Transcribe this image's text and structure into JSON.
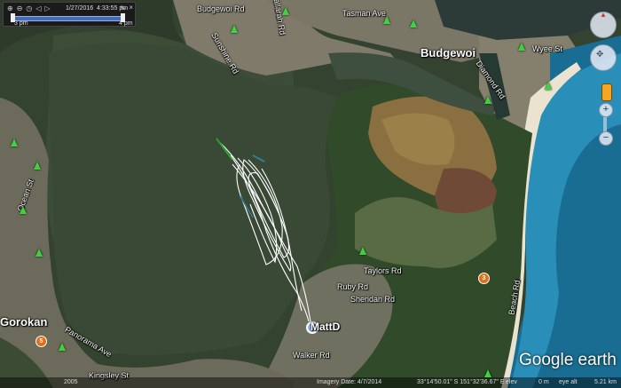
{
  "timebar": {
    "date": "1/27/2016",
    "time": "4:33:55 pm",
    "start": "3 pm",
    "end": "4 pm"
  },
  "towns": {
    "budgewoi": "Budgewoi",
    "gorokan": "Gorokan"
  },
  "placemark": {
    "label": "MattD"
  },
  "streets": [
    "Budgewoi Rd",
    "Sunshine Rd",
    "Wallarah Rd",
    "Tasman Ave",
    "Diamond Rd",
    "Ocean St",
    "Ruby Rd",
    "Sheridan Rd",
    "Kingsley St",
    "Panorama Ave",
    "Taylors Rd",
    "Walker Rd",
    "Beach Rd",
    "Wyee St"
  ],
  "route_shields": [
    "5",
    "3"
  ],
  "status": {
    "imagery": "Imagery Date: 4/7/2014",
    "coords": "33°14'50.01\" S 151°32'36.67\" E",
    "elev": "elev",
    "elev_val": "0 m",
    "eye": "eye alt",
    "eye_val": "5.21 km",
    "year": "2005"
  },
  "logo": "Google earth",
  "colors": {
    "water": "#3c4a36",
    "track": "#ffffff",
    "track_start": "#22a02a",
    "ocean": "#1d7fa6"
  },
  "icons": {
    "zoom_in": "+",
    "zoom_out": "−",
    "close": "×",
    "wrench": "wrench-icon"
  }
}
